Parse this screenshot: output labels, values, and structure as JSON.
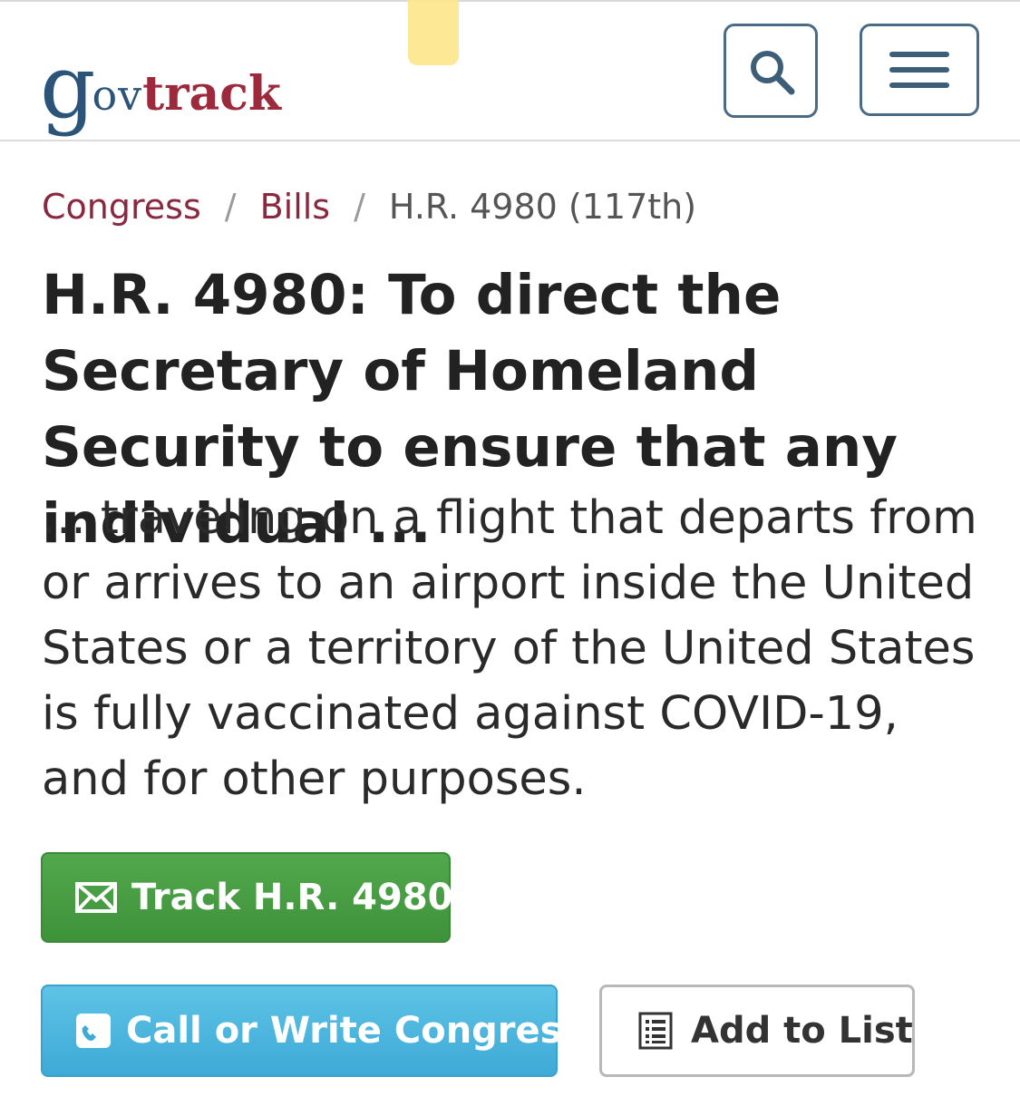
{
  "header": {
    "logo": {
      "g": "g",
      "ov": "ov",
      "track": "track"
    },
    "search_icon": "search-icon",
    "menu_icon": "hamburger-menu-icon"
  },
  "breadcrumb": {
    "items": [
      {
        "label": "Congress"
      },
      {
        "label": "Bills"
      }
    ],
    "separator": "/",
    "current": "H.R. 4980 (117th)"
  },
  "bill": {
    "title": "H.R. 4980: To direct the Secretary of Homeland Security to ensure that any individual ...",
    "subtitle": "... traveling on a flight that departs from or arrives to an airport inside the United States or a territory of the United States is fully vaccinated against COVID-19, and for other purposes."
  },
  "actions": {
    "track_label": "Track H.R. 4980",
    "track_icon": "envelope-icon",
    "call_label": "Call or Write Congress",
    "call_icon": "phone-icon",
    "list_label": "Add to List",
    "list_icon": "list-icon"
  },
  "colors": {
    "brand_blue": "#2b5478",
    "brand_red": "#9c2a3c",
    "track_green": "#46993f",
    "call_blue": "#4bb5dd"
  }
}
